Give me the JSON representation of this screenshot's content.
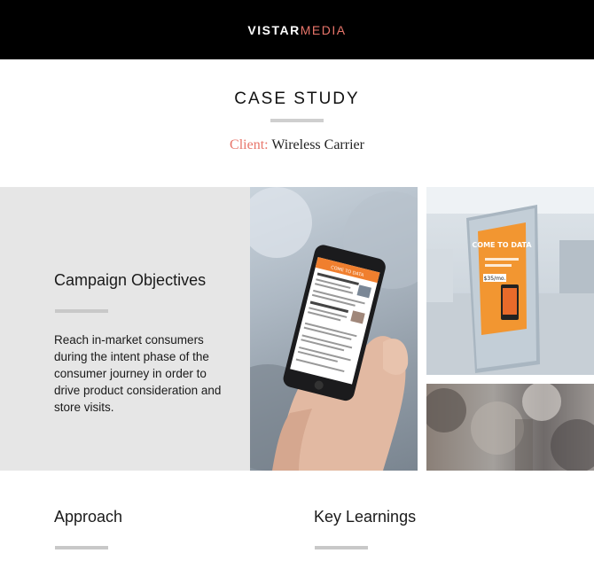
{
  "header": {
    "logo_part1": "VISTAR",
    "logo_part2": "MEDIA"
  },
  "page": {
    "title": "CASE STUDY",
    "client_label": "Client:",
    "client_value": "Wireless Carrier"
  },
  "objectives": {
    "title": "Campaign Objectives",
    "text": "Reach in-market consumers during the intent phase of the consumer journey in order to drive product consideration and store visits."
  },
  "images": {
    "kiosk_headline": "COME TO DATA",
    "kiosk_price": "$35/mo."
  },
  "sections": {
    "approach_title": "Approach",
    "learnings_title": "Key Learnings"
  },
  "colors": {
    "accent": "#e8756a",
    "header_bg": "#000000",
    "panel_bg": "#e6e6e6"
  }
}
